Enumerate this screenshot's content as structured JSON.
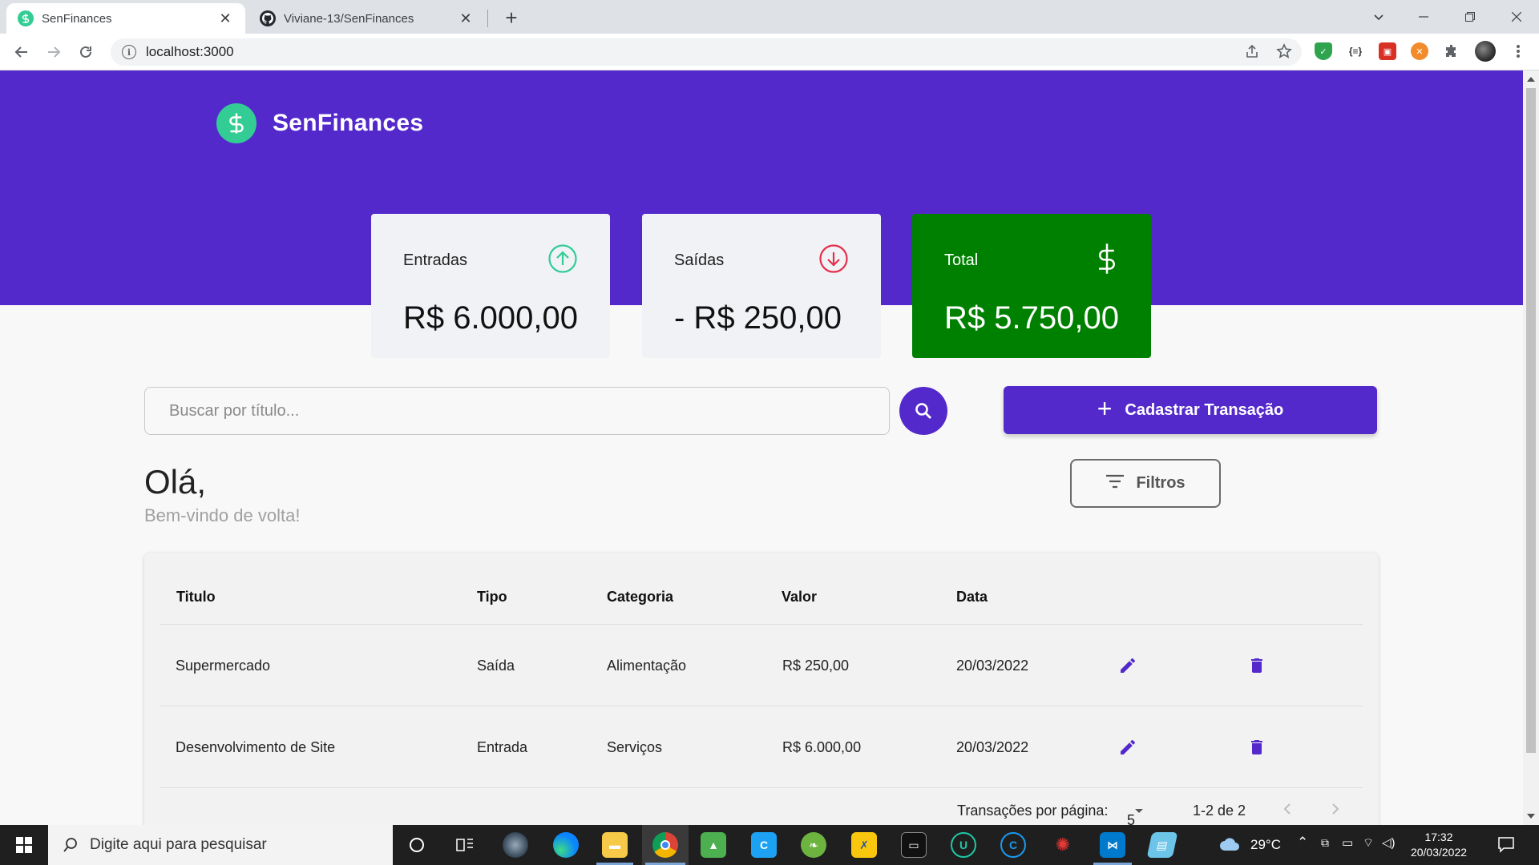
{
  "browser": {
    "tabs": [
      {
        "title": "SenFinances",
        "active": true
      },
      {
        "title": "Viviane-13/SenFinances",
        "active": false
      }
    ],
    "url": "localhost:3000"
  },
  "app": {
    "brand_name": "SenFinances",
    "colors": {
      "primary": "#5429cc",
      "green": "#33cc95",
      "red": "#e52e4d",
      "total_bg": "#008000"
    }
  },
  "summary": {
    "income": {
      "label": "Entradas",
      "value": "R$ 6.000,00",
      "icon": "arrow-up-circle-icon"
    },
    "expense": {
      "label": "Saídas",
      "value": "- R$ 250,00",
      "icon": "arrow-down-circle-icon"
    },
    "total": {
      "label": "Total",
      "value": "R$ 5.750,00",
      "icon": "dollar-icon"
    }
  },
  "search": {
    "placeholder": "Buscar por título...",
    "value": ""
  },
  "actions": {
    "add_label": "Cadastrar Transação",
    "filter_label": "Filtros"
  },
  "greeting": {
    "title": "Olá,",
    "subtitle": "Bem-vindo de volta!"
  },
  "table": {
    "headers": [
      "Titulo",
      "Tipo",
      "Categoria",
      "Valor",
      "Data"
    ],
    "rows": [
      {
        "titulo": "Supermercado",
        "tipo": "Saída",
        "categoria": "Alimentação",
        "valor": "R$ 250,00",
        "data": "20/03/2022"
      },
      {
        "titulo": "Desenvolvimento de Site",
        "tipo": "Entrada",
        "categoria": "Serviços",
        "valor": "R$ 6.000,00",
        "data": "20/03/2022"
      }
    ],
    "pagination": {
      "per_page_label": "Transações por página:",
      "per_page_value": "5",
      "range": "1-2 de 2"
    }
  },
  "taskbar": {
    "search_placeholder": "Digite aqui para pesquisar",
    "weather": "29°C",
    "time": "17:32",
    "date": "20/03/2022"
  }
}
